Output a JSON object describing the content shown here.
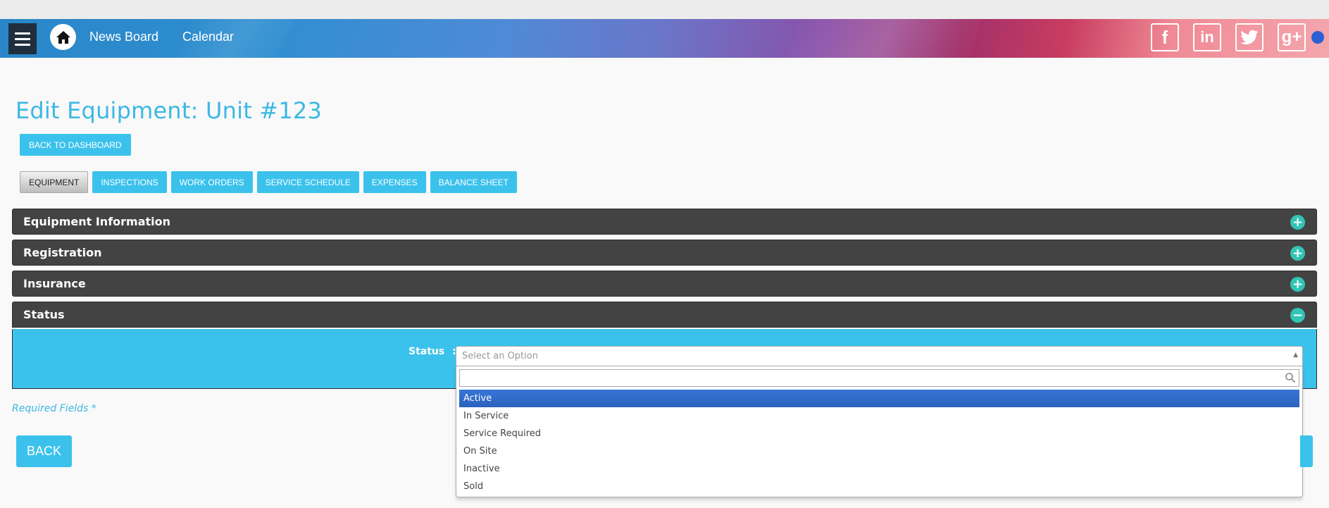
{
  "nav": {
    "links": [
      "News Board",
      "Calendar"
    ],
    "social": [
      {
        "name": "facebook",
        "glyph": "f"
      },
      {
        "name": "linkedin",
        "glyph": "in"
      },
      {
        "name": "twitter",
        "glyph": "🐦"
      },
      {
        "name": "google-plus",
        "glyph": "g+"
      }
    ]
  },
  "page": {
    "title": "Edit Equipment: Unit #123",
    "back_to_dashboard": "BACK TO DASHBOARD"
  },
  "tabs": [
    {
      "label": "EQUIPMENT",
      "active": true
    },
    {
      "label": "INSPECTIONS",
      "active": false
    },
    {
      "label": "WORK ORDERS",
      "active": false
    },
    {
      "label": "SERVICE SCHEDULE",
      "active": false
    },
    {
      "label": "EXPENSES",
      "active": false
    },
    {
      "label": "BALANCE SHEET",
      "active": false
    }
  ],
  "panels": [
    {
      "title": "Equipment Information",
      "expanded": false
    },
    {
      "title": "Registration",
      "expanded": false
    },
    {
      "title": "Insurance",
      "expanded": false
    },
    {
      "title": "Status",
      "expanded": true
    }
  ],
  "status_field": {
    "label": "Status",
    "separator": ":",
    "placeholder": "Select an Option",
    "search_value": "",
    "options": [
      "Active",
      "In Service",
      "Service Required",
      "On Site",
      "Inactive",
      "Sold"
    ],
    "highlighted_index": 0
  },
  "footer": {
    "required_note": "Required Fields *",
    "back_label": "BACK"
  },
  "colors": {
    "accent": "#3bc2ec",
    "title": "#3bb8e4",
    "panel_header": "#434343",
    "panel_icon": "#32c4b5",
    "highlight": "#3875d7"
  }
}
